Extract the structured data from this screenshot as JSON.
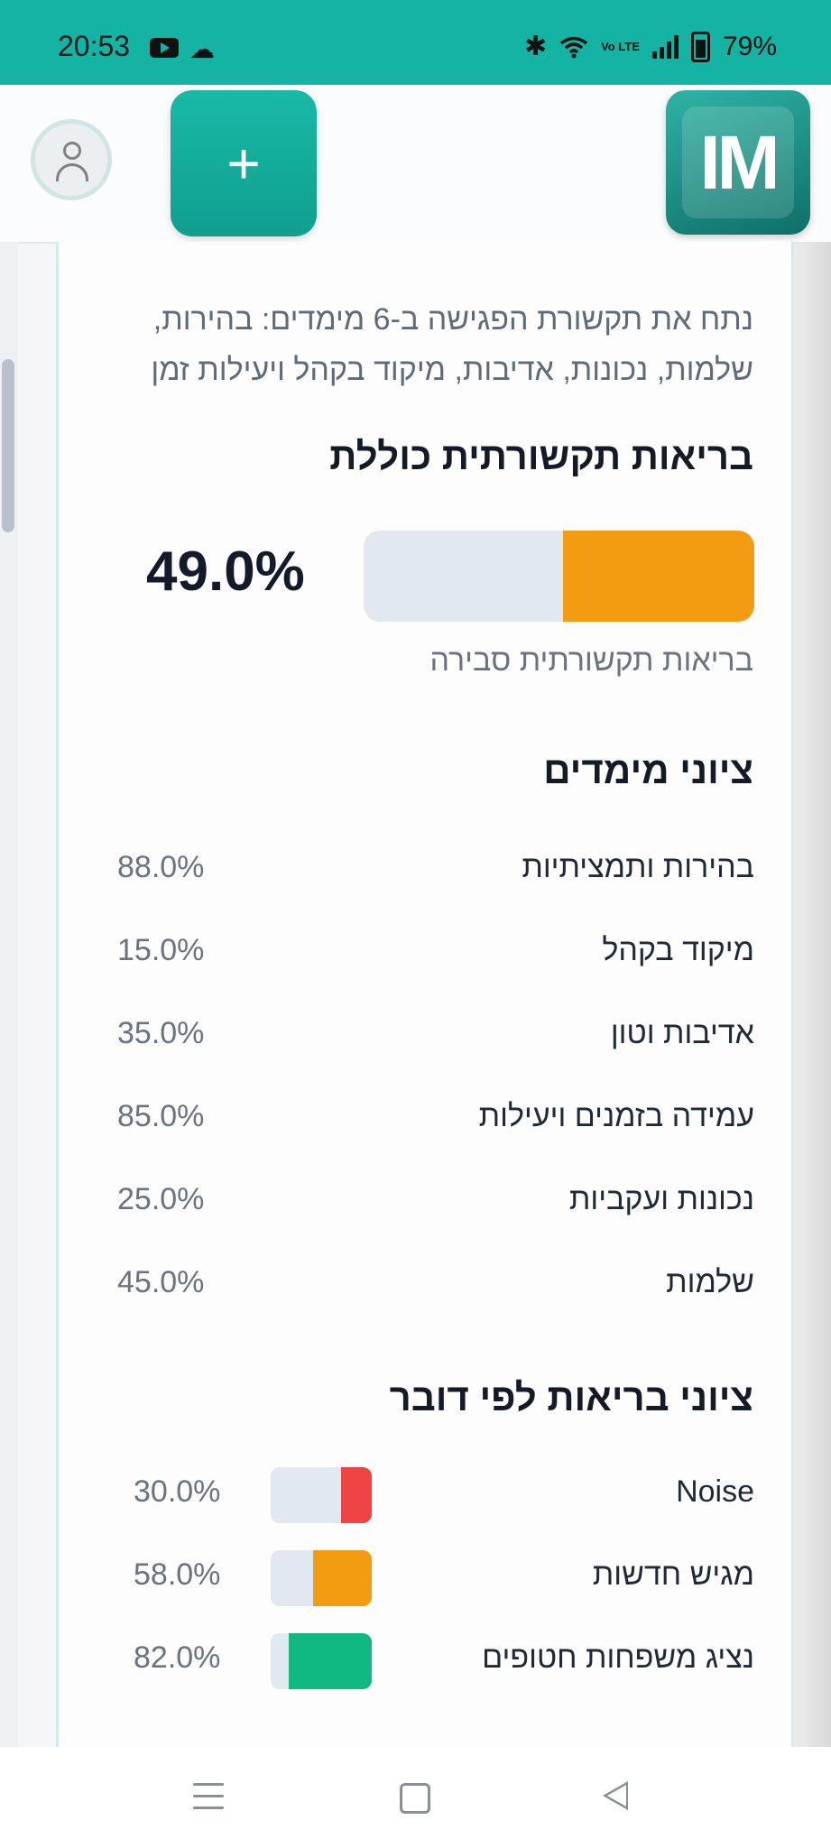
{
  "status_bar": {
    "time": "20:53",
    "battery": "79%",
    "icons": [
      "youtube-icon",
      "cloud-icon",
      "bluetooth-icon",
      "wifi-icon",
      "volte-icon",
      "signal-icon",
      "battery-icon"
    ],
    "volte_text": "Vo LTE"
  },
  "header": {
    "add_label": "+",
    "logo_text": "IM"
  },
  "intro": {
    "text": "נתח את תקשורת הפגישה ב-6 מימדים: בהירות, שלמות, נכונות, אדיבות, מיקוד בקהל ויעילות זמן"
  },
  "overall": {
    "title": "בריאות תקשורתית כוללת",
    "percent_text": "49.0%",
    "value": 0.49,
    "description": "בריאות תקשורתית סבירה",
    "bar_color": "#f39c12"
  },
  "dimensions": {
    "title": "ציוני מימדים",
    "items": [
      {
        "label": "בהירות ותמציתיות",
        "value": "88.0%"
      },
      {
        "label": "מיקוד בקהל",
        "value": "15.0%"
      },
      {
        "label": "אדיבות וטון",
        "value": "35.0%"
      },
      {
        "label": "עמידה בזמנים ויעילות",
        "value": "85.0%"
      },
      {
        "label": "נכונות ועקביות",
        "value": "25.0%"
      },
      {
        "label": "שלמות",
        "value": "45.0%"
      }
    ]
  },
  "speakers": {
    "title": "ציוני בריאות לפי דובר",
    "items": [
      {
        "label": "Noise",
        "value": "30.0%",
        "fraction": 0.3,
        "color": "#ef4444"
      },
      {
        "label": "מגיש חדשות",
        "value": "58.0%",
        "fraction": 0.58,
        "color": "#f39c12"
      },
      {
        "label": "נציג משפחות חטופים",
        "value": "82.0%",
        "fraction": 0.82,
        "color": "#10b981"
      }
    ]
  },
  "colors": {
    "status_bar": "#14b3a3",
    "accent": "#14b3a3",
    "bar_track": "#e2e8f0"
  }
}
